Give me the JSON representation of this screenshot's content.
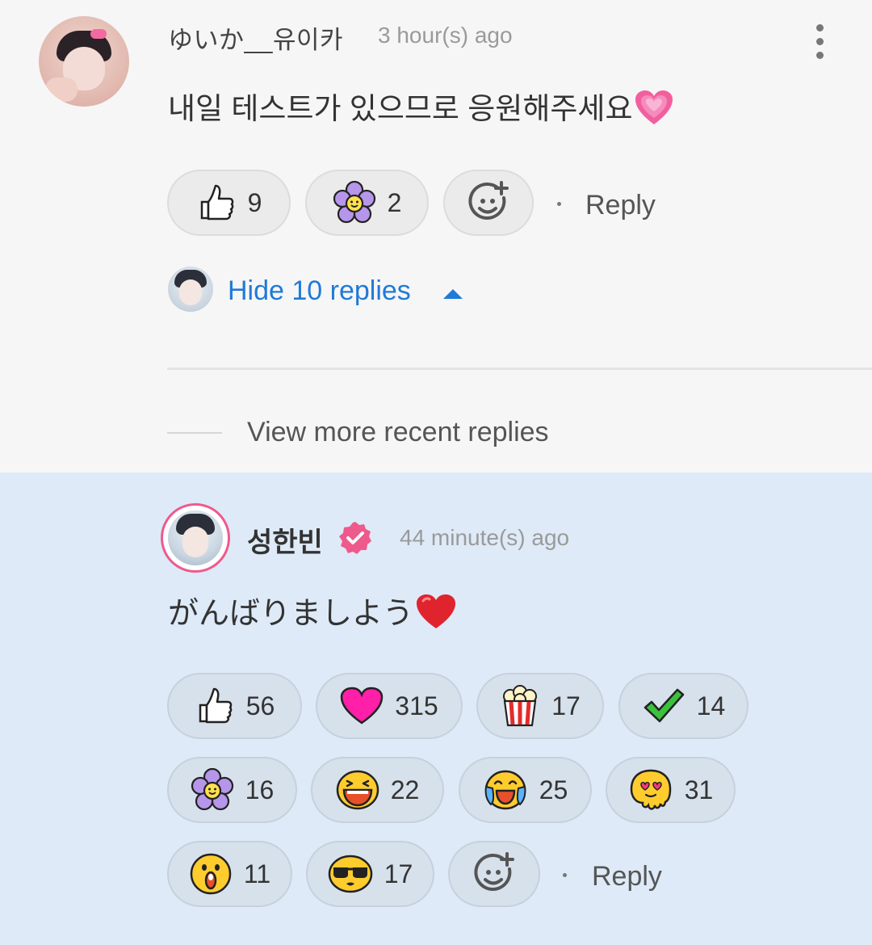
{
  "comment": {
    "username": "ゆいか__유이카",
    "timestamp": "3 hour(s) ago",
    "text": "내일 테스트가 있으므로 응원해주세요",
    "text_emoji": "growing-heart",
    "reactions": [
      {
        "icon": "thumbs-up-icon",
        "count": "9"
      },
      {
        "icon": "purple-flower-icon",
        "count": "2"
      }
    ],
    "add_reaction_icon": "add-reaction-icon",
    "reply_label": "Reply",
    "hide_replies_label": "Hide 10 replies",
    "view_more_label": "View more recent replies"
  },
  "artist_reply": {
    "username": "성한빈",
    "verified_icon": "verified-badge-icon",
    "timestamp": "44 minute(s) ago",
    "text": "がんばりましよう",
    "text_emoji": "red-heart",
    "reactions": [
      {
        "icon": "thumbs-up-icon",
        "count": "56"
      },
      {
        "icon": "pink-heart-icon",
        "count": "315"
      },
      {
        "icon": "popcorn-icon",
        "count": "17"
      },
      {
        "icon": "green-check-icon",
        "count": "14"
      },
      {
        "icon": "purple-flower-icon",
        "count": "16"
      },
      {
        "icon": "laughing-face-icon",
        "count": "22"
      },
      {
        "icon": "crying-laughing-face-icon",
        "count": "25"
      },
      {
        "icon": "heart-eyes-melting-face-icon",
        "count": "31"
      },
      {
        "icon": "surprised-face-icon",
        "count": "11"
      },
      {
        "icon": "sunglasses-face-icon",
        "count": "17"
      }
    ],
    "add_reaction_icon": "add-reaction-icon",
    "reply_label": "Reply"
  },
  "colors": {
    "link_blue": "#1f7ad8",
    "highlight_bg": "#deeaf7",
    "verified_pink": "#ee5a8c"
  }
}
